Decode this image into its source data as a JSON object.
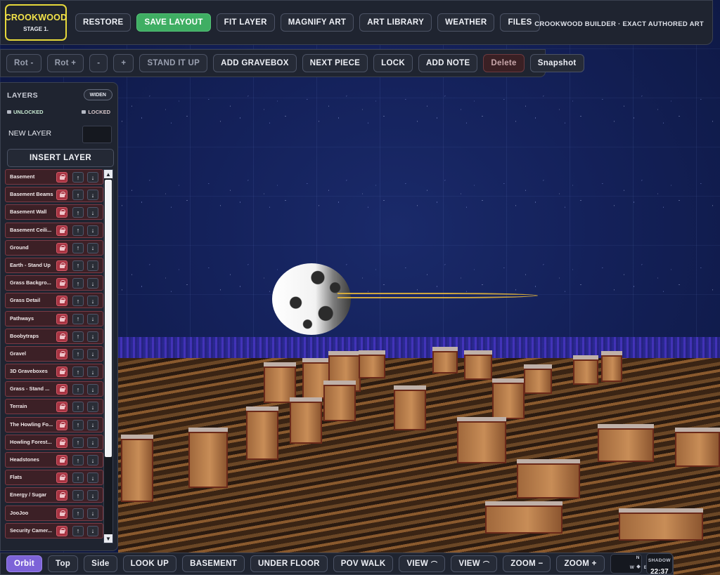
{
  "top_bar": {
    "brand": {
      "name": "CROOKWOOD",
      "stage": "STAGE 1."
    },
    "buttons": [
      "RESTORE",
      "SAVE LAYOUT",
      "FIT LAYER",
      "MAGNIFY ART",
      "ART LIBRARY",
      "WEATHER",
      "FILES"
    ],
    "credit": "CROOKWOOD BUILDER · EXACT AUTHORED ART"
  },
  "toolbar": {
    "rot_minus": "Rot -",
    "rot_plus": "Rot +",
    "minus": "-",
    "plus": "+",
    "stand_it_up": "STAND IT UP",
    "add_gravebox": "ADD GRAVEBOX",
    "next_piece": "NEXT PIECE",
    "lock": "LOCK",
    "add_note": "ADD NOTE",
    "delete": "Delete",
    "snapshot": "Snapshot"
  },
  "layers_panel": {
    "title": "LAYERS",
    "widen": "WIDEN",
    "legend_unlocked": "UNLOCKED",
    "legend_locked": "LOCKED",
    "new_layer_label": "NEW LAYER",
    "new_layer_value": "",
    "insert_layer": "INSERT LAYER",
    "layers": [
      "Basement",
      "Basement Beams",
      "Basement Wall",
      "Basement Ceili...",
      "Ground",
      "Earth - Stand Up",
      "Grass Backgro...",
      "Grass Detail",
      "Pathways",
      "Boobytraps",
      "Gravel",
      "3D Graveboxes",
      "Grass - Stand ...",
      "Terrain",
      "The Howling Fo...",
      "Howling Forest...",
      "Headstones",
      "Flats",
      "Energy / Sugar",
      "JooJoo",
      "Security Camer..."
    ],
    "layer_state": "locked",
    "layers_shown": 21
  },
  "bottom_bar": {
    "orbit": "Orbit",
    "top": "Top",
    "side": "Side",
    "look_up": "LOOK UP",
    "basement": "BASEMENT",
    "under_floor": "UNDER FLOOR",
    "pov_walk": "POV WALK",
    "view_1": "VIEW",
    "view_2": "VIEW",
    "zoom_minus": "ZOOM −",
    "zoom_plus": "ZOOM +",
    "compass": {
      "n": "N",
      "w": "W",
      "e": "E"
    },
    "shadow_label": "SHADOW",
    "shadow_time": "22:37"
  },
  "colors": {
    "accent_primary": "#3fae63",
    "brand_yellow": "#f3e34a",
    "active_mode": "#7d63d8",
    "locked_row": "#3c2026",
    "lock_button": "#a83442",
    "panel_bg": "#1f2430"
  }
}
